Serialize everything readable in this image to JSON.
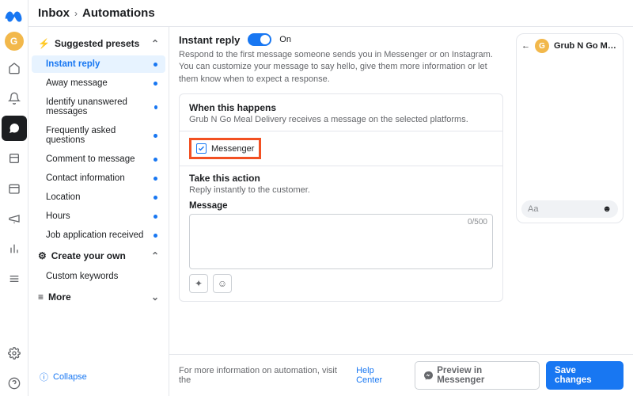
{
  "breadcrumbs": {
    "root": "Inbox",
    "current": "Automations"
  },
  "avatar_letter": "G",
  "sidebar": {
    "sections": {
      "suggested": {
        "label": "Suggested presets"
      },
      "create": {
        "label": "Create your own"
      },
      "more": {
        "label": "More"
      }
    },
    "suggested_items": [
      {
        "label": "Instant reply",
        "selected": true,
        "dot": true
      },
      {
        "label": "Away message",
        "dot": true
      },
      {
        "label": "Identify unanswered messages",
        "dot": true
      },
      {
        "label": "Frequently asked questions",
        "dot": true
      },
      {
        "label": "Comment to message",
        "dot": true
      },
      {
        "label": "Contact information",
        "dot": true
      },
      {
        "label": "Location",
        "dot": true
      },
      {
        "label": "Hours",
        "dot": true
      },
      {
        "label": "Job application received",
        "dot": true
      }
    ],
    "create_items": [
      {
        "label": "Custom keywords"
      }
    ],
    "collapse": "Collapse"
  },
  "instant_reply": {
    "title": "Instant reply",
    "state": "On",
    "description": "Respond to the first message someone sends you in Messenger or on Instagram. You can customize your message to say hello, give them more information or let them know when to expect a response.",
    "when_title": "When this happens",
    "when_sub": "Grub N Go Meal Delivery receives a message on the selected platforms.",
    "platform": "Messenger",
    "action_title": "Take this action",
    "action_sub": "Reply instantly to the customer.",
    "message_label": "Message",
    "message_value": "",
    "message_count": "0/500"
  },
  "preview": {
    "page_name": "Grub N Go M…",
    "input_placeholder": "Aa"
  },
  "footer": {
    "text": "For more information on automation, visit the ",
    "link": "Help Center",
    "preview_btn": "Preview in Messenger",
    "save_btn": "Save changes"
  }
}
